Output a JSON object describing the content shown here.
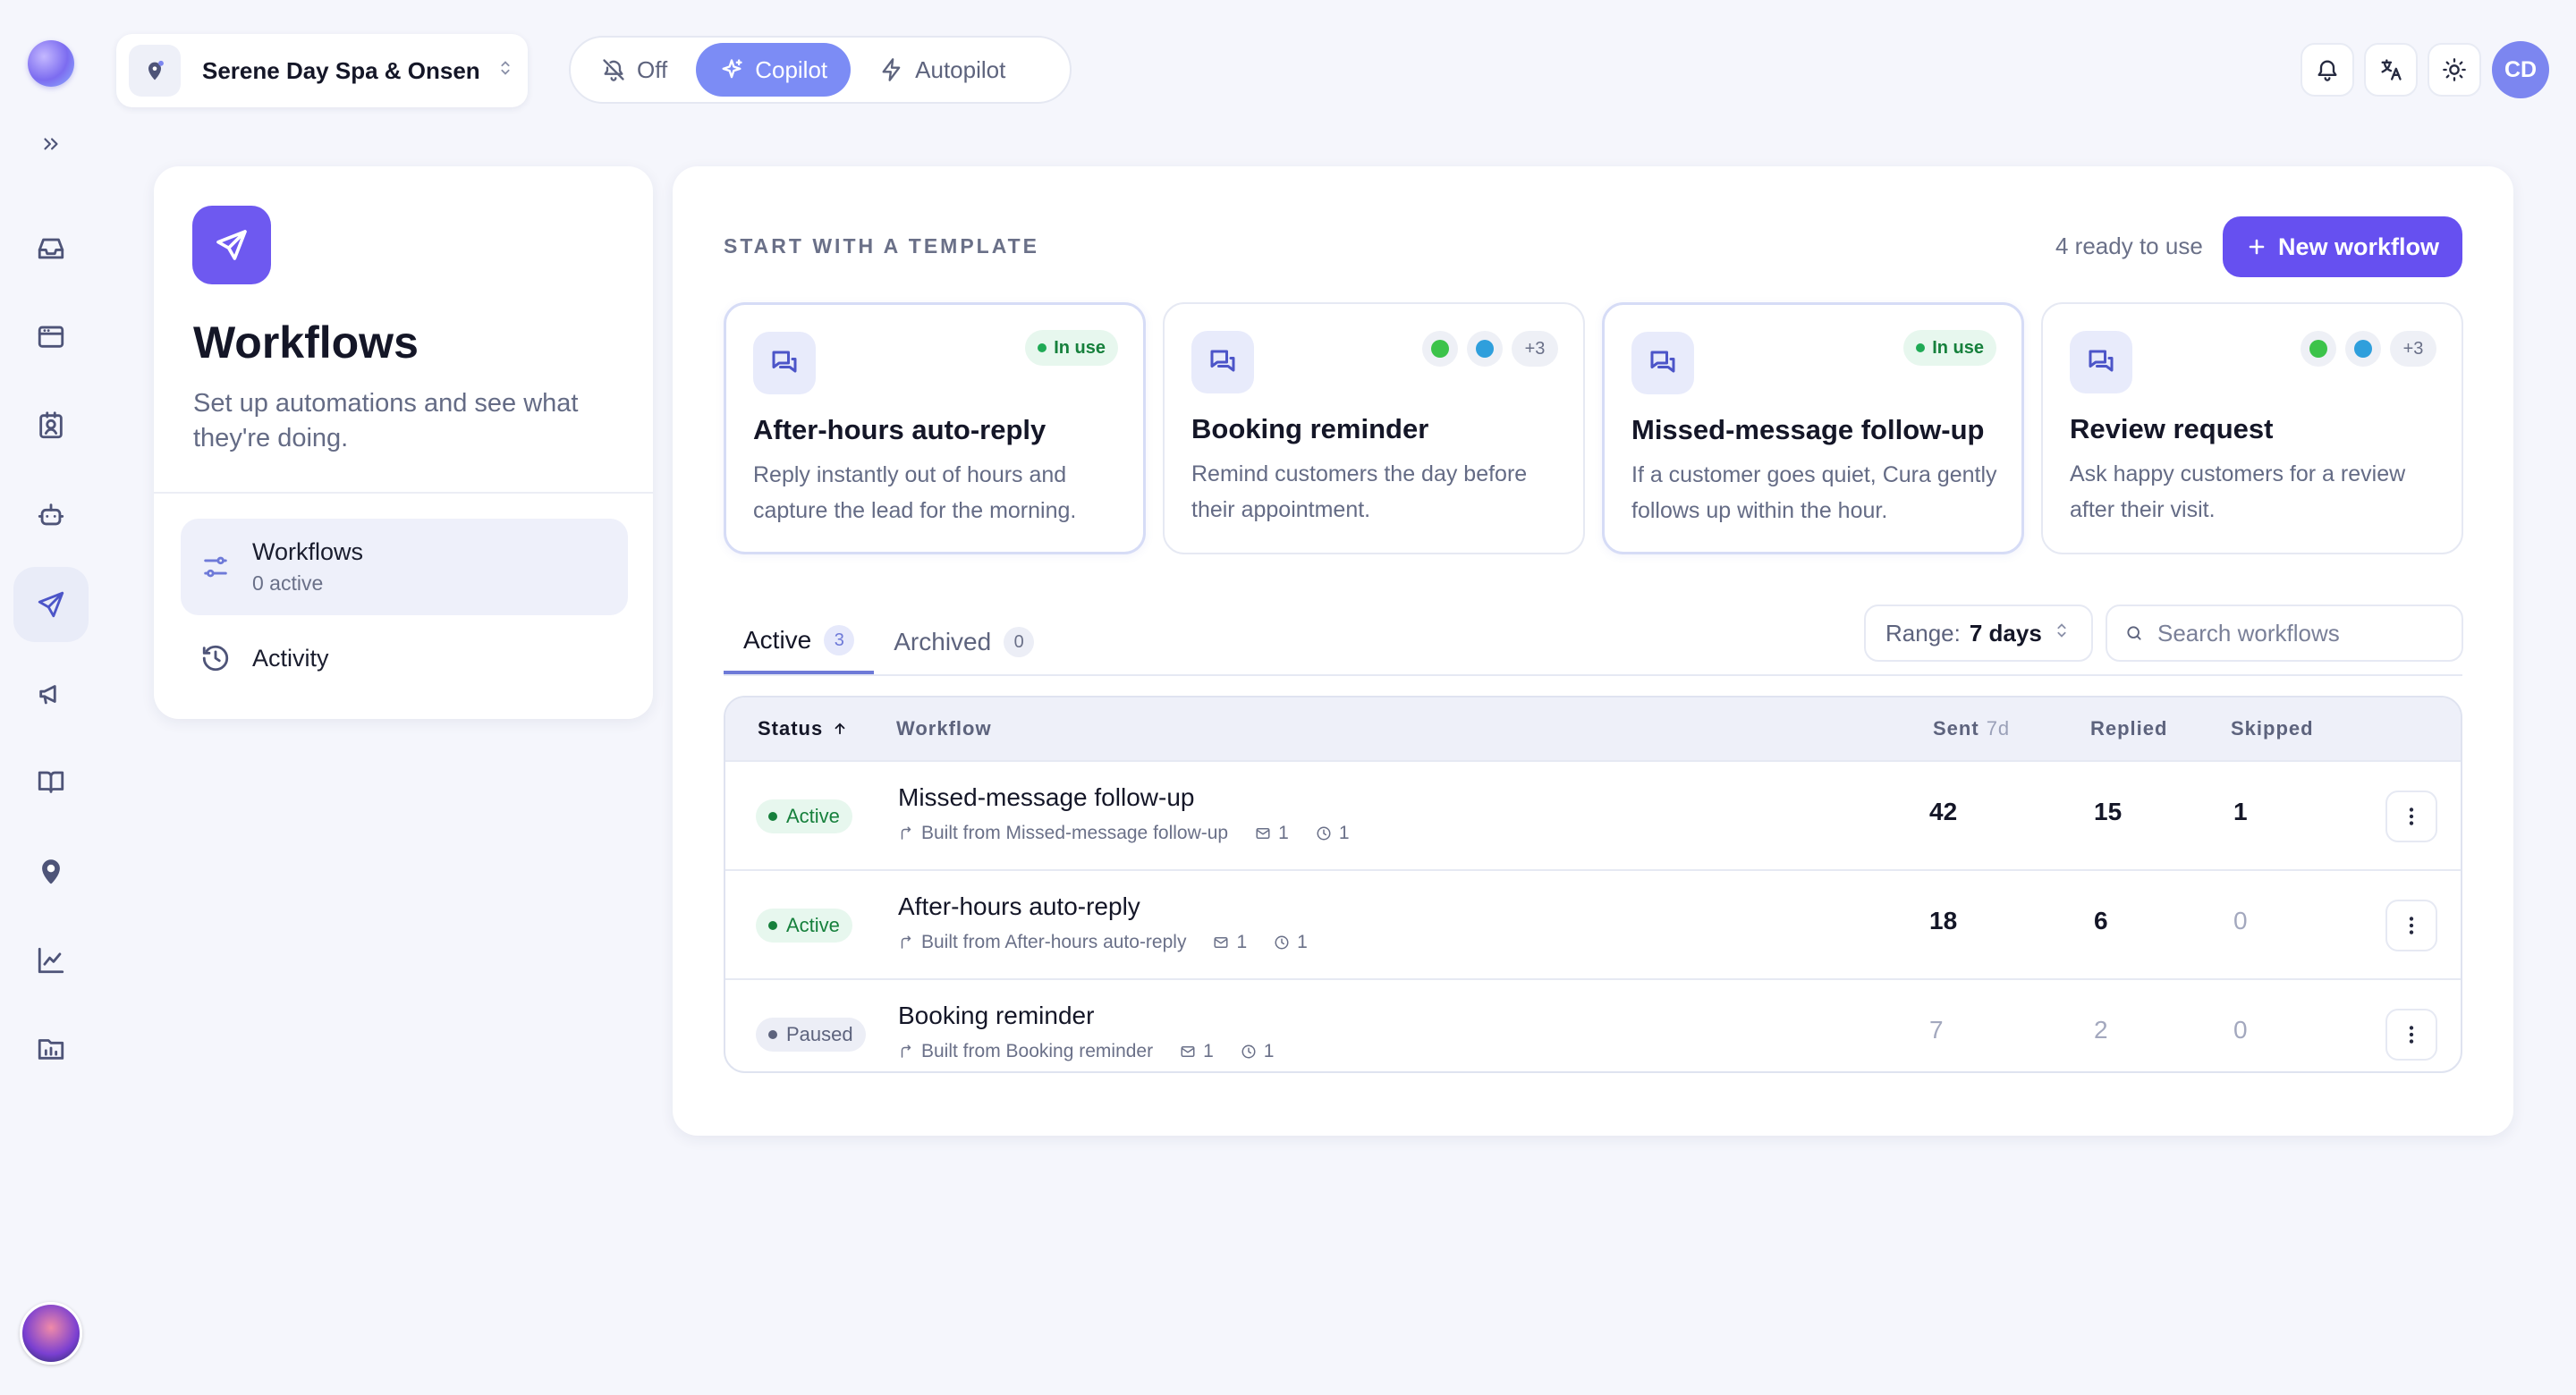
{
  "workspace": {
    "name": "Serene Day Spa & Onsen",
    "chevron": "⌃⌄"
  },
  "modes": [
    {
      "label": "Off",
      "icon": "bell-off-icon",
      "active": false
    },
    {
      "label": "Copilot",
      "icon": "sparkles-icon",
      "active": true
    },
    {
      "label": "Autopilot",
      "icon": "bolt-icon",
      "active": false
    }
  ],
  "user": {
    "initials": "CD"
  },
  "panel": {
    "title": "Workflows",
    "subtitle": "Set up automations and see what they're doing.",
    "nav": [
      {
        "label": "Workflows",
        "sub": "0 active"
      },
      {
        "label": "Activity"
      }
    ]
  },
  "templates": {
    "heading": "START WITH A TEMPLATE",
    "ready": "4 ready to use",
    "new_button": "New workflow",
    "in_use_label": "In use",
    "more_label": "+3",
    "cards": [
      {
        "title": "After-hours auto-reply",
        "desc": "Reply instantly out of hours and capture the lead for the morning.",
        "in_use": true
      },
      {
        "title": "Booking reminder",
        "desc": "Remind customers the day before their appointment.",
        "in_use": false
      },
      {
        "title": "Missed-message follow-up",
        "desc": "If a customer goes quiet, Cura gently follows up within the hour.",
        "in_use": true
      },
      {
        "title": "Review request",
        "desc": "Ask happy customers for a review after their visit.",
        "in_use": false
      }
    ]
  },
  "tabs": [
    {
      "label": "Active",
      "count": "3"
    },
    {
      "label": "Archived",
      "count": "0"
    }
  ],
  "range": {
    "label": "Range:",
    "value": "7 days"
  },
  "search": {
    "placeholder": "Search workflows"
  },
  "table": {
    "headers": {
      "status": "Status",
      "workflow": "Workflow",
      "sent": "Sent",
      "sent_sub": "7d",
      "replied": "Replied",
      "skipped": "Skipped"
    },
    "rows": [
      {
        "status": "Active",
        "name": "Missed-message follow-up",
        "built": "Built from Missed-message follow-up",
        "msgs": "1",
        "delay": "1",
        "sent": "42",
        "replied": "15",
        "skipped": "1"
      },
      {
        "status": "Active",
        "name": "After-hours auto-reply",
        "built": "Built from After-hours auto-reply",
        "msgs": "1",
        "delay": "1",
        "sent": "18",
        "replied": "6",
        "skipped": "0"
      },
      {
        "status": "Paused",
        "name": "Booking reminder",
        "built": "Built from Booking reminder",
        "msgs": "1",
        "delay": "1",
        "sent": "7",
        "replied": "2",
        "skipped": "0"
      }
    ]
  },
  "colors": {
    "accent": "#6650f0",
    "copilot": "#7c8cf5",
    "active_green": "#16803c"
  }
}
